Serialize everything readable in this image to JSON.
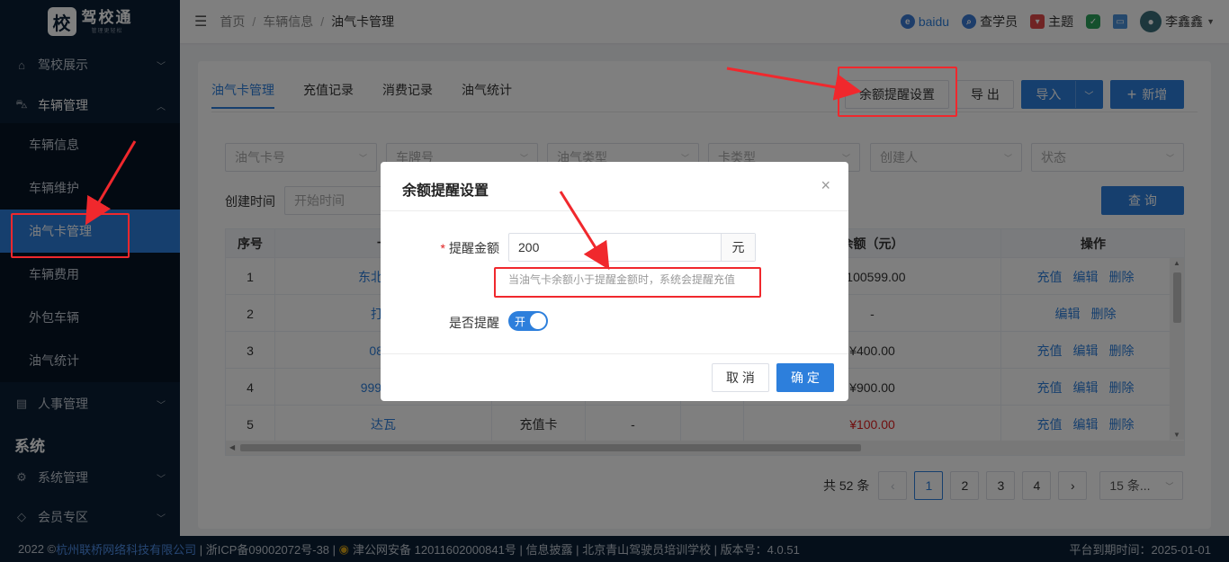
{
  "app": {
    "logo_char": "校",
    "title": "驾校通",
    "subtitle": "管理更轻松"
  },
  "sidebar": {
    "groups": [
      {
        "label": "驾校展示",
        "icon": "home-icon",
        "arrow": "﹀"
      },
      {
        "label": "车辆管理",
        "icon": "car-icon",
        "arrow": "︿"
      },
      {
        "label": "人事管理",
        "icon": "people-icon",
        "arrow": "﹀"
      },
      {
        "label": "系统管理",
        "icon": "gear-icon",
        "arrow": "﹀"
      },
      {
        "label": "会员专区",
        "icon": "diamond-icon",
        "arrow": "﹀"
      }
    ],
    "sub_items": [
      {
        "label": "车辆信息"
      },
      {
        "label": "车辆维护"
      },
      {
        "label": "油气卡管理"
      },
      {
        "label": "车辆费用"
      },
      {
        "label": "外包车辆"
      },
      {
        "label": "油气统计"
      }
    ],
    "section_label": "系统"
  },
  "header": {
    "breadcrumb": [
      "首页",
      "车辆信息",
      "油气卡管理"
    ],
    "baidu": "baidu",
    "query_staff": "查学员",
    "theme": "主题",
    "user": "李鑫鑫"
  },
  "tabs": [
    "油气卡管理",
    "充值记录",
    "消费记录",
    "油气统计"
  ],
  "actions": {
    "balance_reminder": "余额提醒设置",
    "export": "导 出",
    "import": "导入",
    "add": "新增",
    "query": "查 询"
  },
  "filters": {
    "card_no": "油气卡号",
    "plate": "车牌号",
    "oil_type": "油气类型",
    "card_type": "卡类型",
    "creator": "创建人",
    "status": "状态",
    "created_time_label": "创建时间",
    "start_time": "开始时间"
  },
  "table": {
    "headers": [
      "序号",
      "卡",
      "",
      "",
      "",
      "余额（元）",
      "操作"
    ],
    "rows": [
      {
        "no": "1",
        "card": "东北中国",
        "type": "",
        "c3": "",
        "balance": "¥100599.00",
        "balance_red": false,
        "ops": [
          "充值",
          "编辑",
          "删除"
        ]
      },
      {
        "no": "2",
        "card": "打撒",
        "type": "",
        "c3": "",
        "balance": "-",
        "balance_red": false,
        "ops": [
          "编辑",
          "删除"
        ]
      },
      {
        "no": "3",
        "card": "0888",
        "type": "",
        "c3": "",
        "balance": "¥400.00",
        "balance_red": false,
        "ops": [
          "充值",
          "编辑",
          "删除"
        ]
      },
      {
        "no": "4",
        "card": "9997 89",
        "type": "",
        "c3": "",
        "balance": "¥900.00",
        "balance_red": false,
        "ops": [
          "充值",
          "编辑",
          "删除"
        ]
      },
      {
        "no": "5",
        "card": "达瓦",
        "type": "充值卡",
        "c3": "-",
        "balance": "¥100.00",
        "balance_red": true,
        "ops": [
          "充值",
          "编辑",
          "删除"
        ]
      }
    ]
  },
  "pagination": {
    "total": "共 52 条",
    "pages": [
      "1",
      "2",
      "3",
      "4"
    ],
    "current": "1",
    "page_size": "15 条..."
  },
  "footer": {
    "copyright_prefix": "2022 ©",
    "company": "杭州联桥网络科技有限公司",
    "rest": " | 浙ICP备09002072号-38 | ",
    "police": "津公网安备 12011602000841号 | 信息披露 | 北京青山驾驶员培训学校 | 版本号：4.0.51",
    "expiry": "平台到期时间：2025-01-01"
  },
  "dialog": {
    "title": "余额提醒设置",
    "close": "×",
    "amount_label": "提醒金额",
    "required_mark": "*",
    "amount_value": "200",
    "amount_unit": "元",
    "hint": "当油气卡余额小于提醒金额时，系统会提醒充值",
    "remind_label": "是否提醒",
    "switch_text": "开",
    "switch_on": true,
    "cancel": "取 消",
    "confirm": "确 定"
  },
  "colors": {
    "primary": "#2d7fdc",
    "sidebar": "#0b1f35",
    "annotation": "#f0282d"
  }
}
